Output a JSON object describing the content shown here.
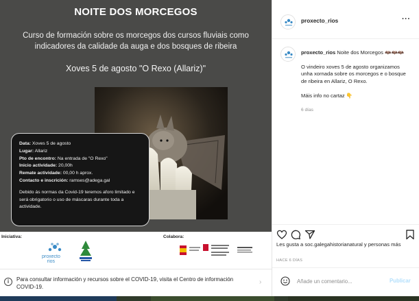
{
  "poster": {
    "title": "NOITE DOS MORCEGOS",
    "subtitle": "Curso de formación sobre os morcegos dos cursos fluviais como indicadores da calidade da auga e dos bosques de ribeira",
    "date_line": "Xoves 5 de agosto \"O Rexo (Allariz)\"",
    "details": [
      {
        "label": "Data:",
        "value": "Xoves 5 de agosto"
      },
      {
        "label": "Lugar:",
        "value": "Allariz"
      },
      {
        "label": "Pto de encontro:",
        "value": "Na entrada de \"O Rexo\""
      },
      {
        "label": "Inicio actividade:",
        "value": "20,00h"
      },
      {
        "label": "Remate actividade:",
        "value": "00,00 h aprox."
      },
      {
        "label": "Contacto e inscrición:",
        "value": "ramses@adega.gal"
      }
    ],
    "note": "Debido ás normas da Covid-19 teremos aforo limitado e será obrigatorio o uso de máscaras durante toda a actividade.",
    "initiative_label": "Iniciativa:",
    "collaborates_label": "Colabora:",
    "rios_logo_text": "proxecto\nrios"
  },
  "covid_banner": {
    "text": "Para consultar información y recursos sobre el COVID-19, visita el Centro de información COVID-19.",
    "icon": "info-icon"
  },
  "post": {
    "username": "proxecto_rios",
    "caption_title": "Noite dos Morcegos 🦇🦇🦇",
    "caption_body": "O vindeiro xoves 5 de agosto organizamos unha xornada sobre os morcegos e o bosque de ribeira en Allariz, O Rexo.",
    "caption_more": "Máis info no cartaz 👇",
    "caption_time": "6 días",
    "likes_text": "Les gusta a soc.galegahistorianatural y personas más",
    "post_time": "HACE 6 DÍAS",
    "comment_placeholder": "Añade un comentario...",
    "publish_label": "Publicar",
    "more_label": "···"
  },
  "colors": {
    "poster_bg": "#4a4a48",
    "info_box_bg": "#161616",
    "publish_disabled": "#b2dffc",
    "link_blue": "#3a8bc6"
  }
}
